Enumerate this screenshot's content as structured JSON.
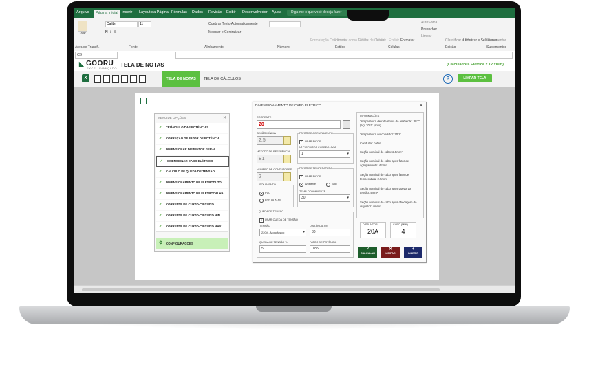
{
  "excel": {
    "tabs": [
      "Arquivo",
      "Página Inicial",
      "Inserir",
      "Layout da Página",
      "Fórmulas",
      "Dados",
      "Revisão",
      "Exibir",
      "Desenvolvedor",
      "Ajuda"
    ],
    "active_tab": "Página Inicial",
    "search_placeholder": "Diga-me o que você deseja fazer",
    "ribbon_groups": [
      "Área de Transf...",
      "Fonte",
      "Alinhamento",
      "Número",
      "Estilos",
      "Células",
      "Edição",
      "Suplementos"
    ],
    "ribbon_labels": {
      "paste": "Colar",
      "font_name": "Calibri",
      "font_size": "11",
      "wrap": "Quebrar Texto Automaticamente",
      "merge": "Mesclar e Centralizar",
      "cond_format": "Formatação Condicional",
      "format_table": "Formatar como Tabela",
      "cell_styles": "Estilos de Células",
      "insert": "Inserir",
      "delete": "Excluir",
      "format": "Formatar",
      "autosum": "AutoSoma",
      "fill": "Preencher",
      "clear": "Limpar",
      "sort": "Classificar e Filtrar",
      "find": "Localizar e Selecionar",
      "addins": "Suplementos"
    },
    "name_box": "C9"
  },
  "app": {
    "logo_text": "GOORU",
    "logo_sub": "EXCEL AVANÇADO",
    "title": "TELA DE NOTAS",
    "file_name": "(Calculadora Elétrica 2.12.xlsm)",
    "nav_tabs": [
      "TELA DE NOTAS",
      "TELA DE CÁLCULOS"
    ],
    "help": "?",
    "clear_button": "LIMPAR TELA"
  },
  "menu": {
    "title": "MENU DE OPÇÕES",
    "items": [
      "TRIÂNGULO DAS POTÊNCIAS",
      "CORREÇÃO DE FATOR DE POTÊNCIA",
      "DIMENSIONAR DISJUNTOR GERAL",
      "DIMENSIONAR CABO ELÉTRICO",
      "CÁLCULO DE QUEDA DE TENSÃO",
      "DIMENSIONAMENTO DE ELETRODUTO",
      "DIMENSIONAMENTO DE ELETROCALHA",
      "CORRENTE DE CURTO-CIRCUITO",
      "CORRENTE DE CURTO-CIRCUITO MÍN",
      "CORRENTE DE CURTO-CIRCUITO MÁX"
    ],
    "config": "CONFIGURAÇÕES"
  },
  "dialog": {
    "title": "DIMENSIONAMENTO DE CABO ELÉTRICO",
    "corrente_label": "CORRENTE",
    "corrente_value": "20",
    "secao_label": "SEÇÃO MÍNIMA",
    "secao_value": "2.5",
    "metodo_label": "MÉTODO DE REFERÊNCIA",
    "metodo_value": "B1",
    "condutores_label": "NÚMERO DE CONDUTORES",
    "condutores_value": "2",
    "isolamento_label": "ISOLAMENTO",
    "isolamento_options": [
      "PVC",
      "EPR ou XLPE"
    ],
    "agrupamento_label": "FATOR DE AGRUPAMENTO",
    "usar_fator": "USAR FATOR",
    "circuitos_label": "Nº CIRCUITOS CARREGADOS",
    "circuitos_value": "1",
    "temperatura_label": "FATOR DE TEMPERATURA",
    "ambiente_options": [
      "Ambiente",
      "Solo"
    ],
    "temp_ambiente_label": "TEMP. DO AMBIENTE",
    "temp_ambiente_value": "30",
    "queda_frame": "QUEDA DE TENSÃO",
    "usar_queda": "USAR QUEDA DE TENSÃO",
    "tensao_label": "TENSÃO",
    "tensao_value": "220V - Monofásico",
    "distancia_label": "DISTÂNCIA (m)",
    "distancia_value": "30",
    "queda_pct_label": "QUEDA DE TENSÃO %",
    "queda_pct_value": "5",
    "fator_pot_label": "FATOR DE POTÊNCIA",
    "fator_pot_value": "0.85",
    "info_title": "INFORMAÇÕES",
    "info_lines": [
      "Temperatura de referência do ambiente: 30°C (ar), 20°C (solo)",
      "Temperatura no condutor: 70°C",
      "Condutor: cobre",
      "Seção nominal do cabo: 2.5mm²",
      "Seção nominal do cabo após fator de agrupamento: 4mm²",
      "Seção nominal do cabo após fator de temperatura: 2.5mm²",
      "Seção nominal do cabo após queda da tensão: 4mm²",
      "Seção nominal do cabo após checagem do disjuntor: 4mm²"
    ],
    "disjuntor_label": "DISJUNTOR",
    "disjuntor_value": "20A",
    "cabo_label": "CABO (mm²)",
    "cabo_value": "4",
    "btn_calcular": "CALCULAR",
    "btn_limpar": "LIMPAR",
    "btn_inserir": "INSERIR"
  },
  "colors": {
    "excel_green": "#1e6e3f",
    "accent_green": "#5cc040",
    "calc_btn": "#1e5e2c",
    "clear_btn": "#7a1c1c",
    "insert_btn": "#1d2a6b"
  }
}
